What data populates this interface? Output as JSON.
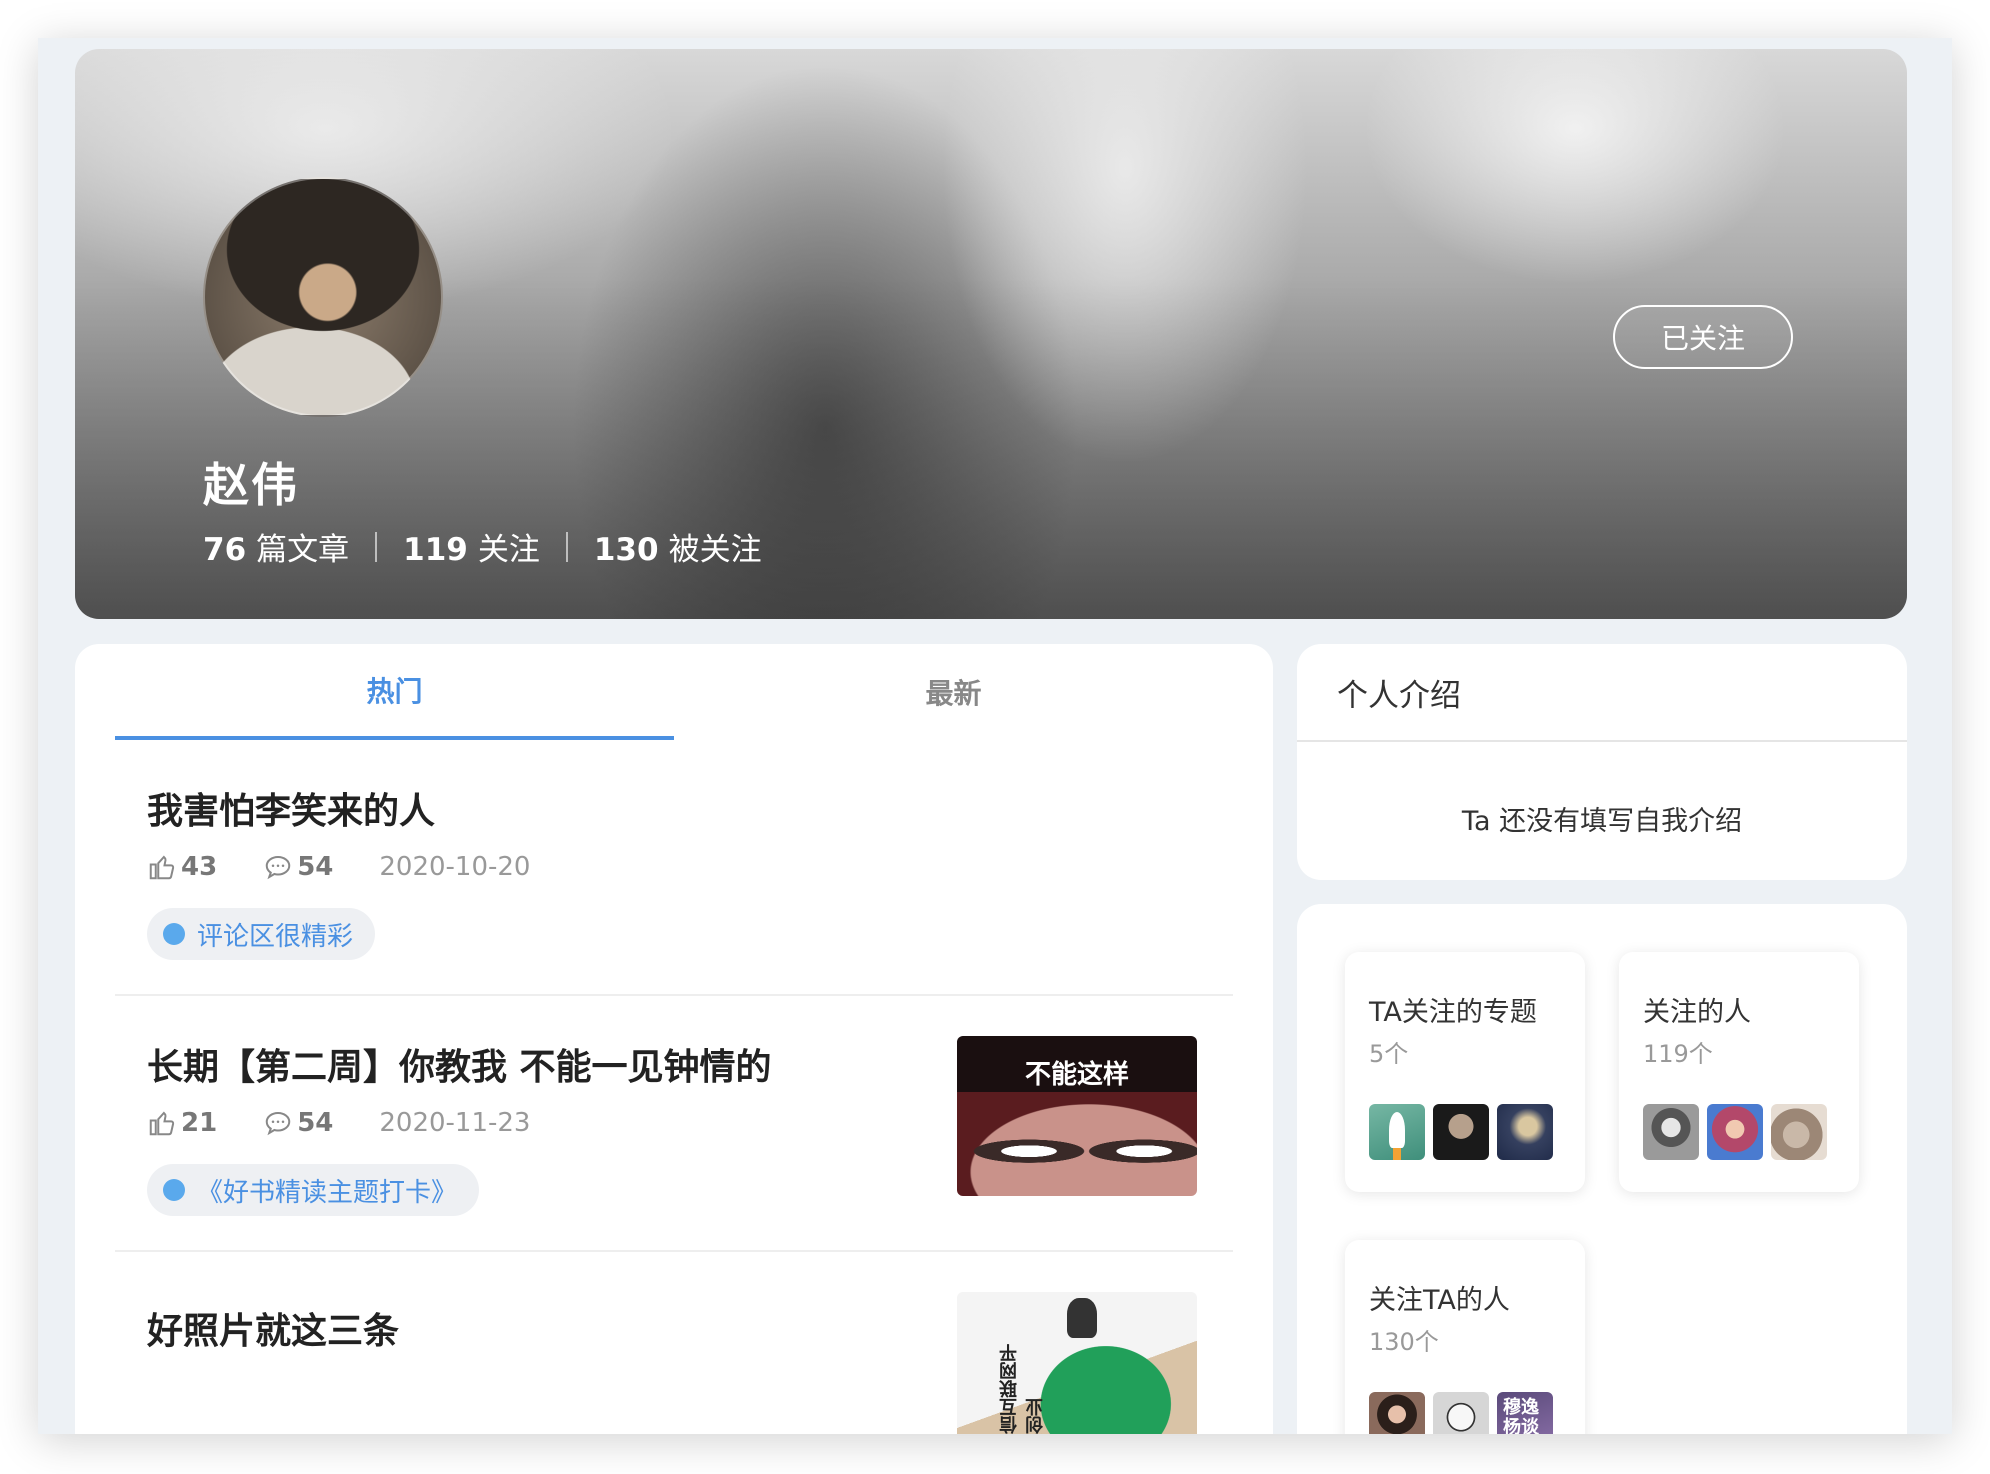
{
  "profile": {
    "name": "赵伟",
    "follow_button": "已关注",
    "stats": [
      {
        "num": "76",
        "label": "篇文章"
      },
      {
        "num": "119",
        "label": "关注"
      },
      {
        "num": "130",
        "label": "被关注"
      }
    ]
  },
  "tabs": [
    {
      "label": "热门",
      "active": true
    },
    {
      "label": "最新",
      "active": false
    }
  ],
  "articles": [
    {
      "title": "我害怕李笑来的人",
      "likes": "43",
      "comments": "54",
      "date": "2020-10-20",
      "tag": "评论区很精彩"
    },
    {
      "title": "长期【第二周】你教我 不能一见钟情的",
      "likes": "21",
      "comments": "54",
      "date": "2020-11-23",
      "tag": "《好书精读主题打卡》",
      "thumb_caption": "不能这样"
    },
    {
      "title": "好照片就这三条",
      "thumb_caption": "微信互联网平民创业"
    }
  ],
  "intro": {
    "heading": "个人介绍",
    "empty_text": "Ta 还没有填写自我介绍"
  },
  "relations": [
    {
      "title": "TA关注的专题",
      "count": "5个"
    },
    {
      "title": "关注的人",
      "count": "119个"
    },
    {
      "title": "关注TA的人",
      "count": "130个",
      "thumb_text": "穆逸杨谈"
    }
  ],
  "colors": {
    "accent": "#4a90e2",
    "tag_dot": "#5aa9ec",
    "page_bg": "#edf1f5"
  }
}
